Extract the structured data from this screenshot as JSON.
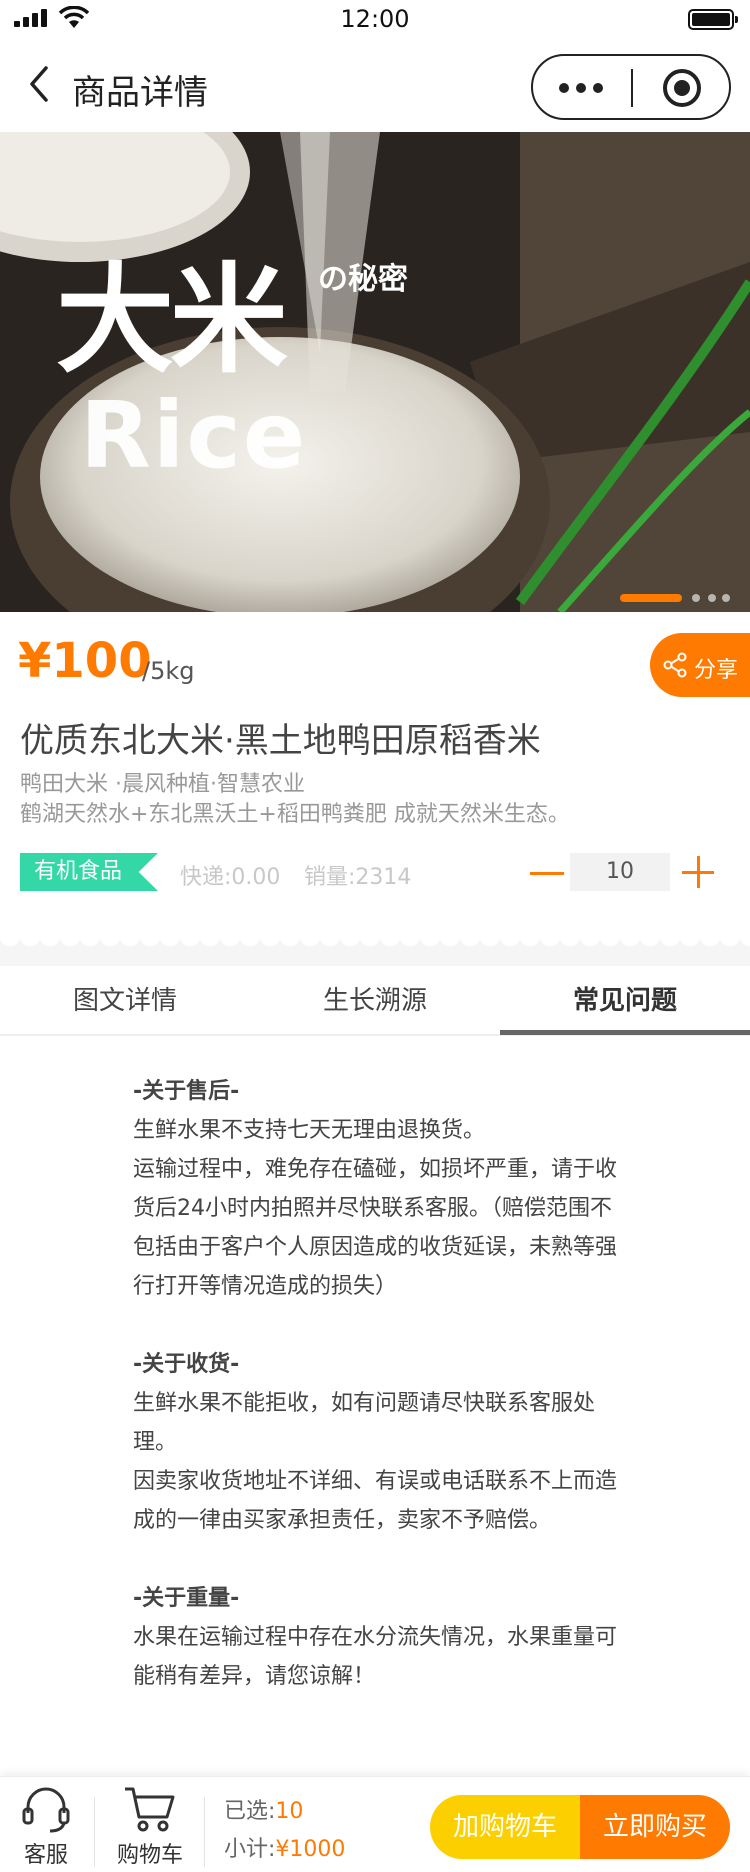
{
  "status_bar": {
    "time": "12:00"
  },
  "nav": {
    "title": "商品详情"
  },
  "hero": {
    "title_cn": "大米",
    "title_sub": "の秘密",
    "title_en": "Rice"
  },
  "product": {
    "price": "¥100",
    "unit": "/5kg",
    "share_label": "分享",
    "title": "优质东北大米·黑土地鸭田原稻香米",
    "subtitle": "鸭田大米 ·晨风种植·智慧农业",
    "description": "鹤湖天然水+东北黑沃土+稻田鸭粪肥 成就天然米生态。",
    "badge": "有机食品",
    "shipping": "快递:0.00",
    "sales": "销量:2314",
    "quantity": "10"
  },
  "tabs": [
    "图文详情",
    "生长溯源",
    "常见问题"
  ],
  "active_tab": "常见问题",
  "faq": {
    "aftersale_heading": "-关于售后-",
    "aftersale_1": "生鲜水果不支持七天无理由退换货。",
    "aftersale_2": "运输过程中，难免存在磕碰，如损坏严重，请于收货后24小时内拍照并尽快联系客服。（赔偿范围不包括由于客户个人原因造成的收货延误，未熟等强行打开等情况造成的损失）",
    "receive_heading": "-关于收货-",
    "receive_1": "生鲜水果不能拒收，如有问题请尽快联系客服处理。",
    "receive_2": "因卖家收货地址不详细、有误或电话联系不上而造成的一律由买家承担责任，卖家不予赔偿。",
    "weight_heading": "-关于重量-",
    "weight_1": "水果在运输过程中存在水分流失情况，水果重量可能稍有差异，请您谅解！"
  },
  "bottom_bar": {
    "service_label": "客服",
    "cart_label": "购物车",
    "selected_label": "已选:",
    "selected_value": "10",
    "subtotal_label": "小计:",
    "subtotal_value": "¥1000",
    "add_cart_label": "加购物车",
    "buy_now_label": "立即购买"
  },
  "colors": {
    "accent": "#ff7a00",
    "yellow": "#fcd000",
    "badge": "#33d8a6"
  },
  "icons": [
    "back-icon",
    "more-icon",
    "target-icon",
    "share-icon",
    "headset-icon",
    "cart-icon"
  ]
}
